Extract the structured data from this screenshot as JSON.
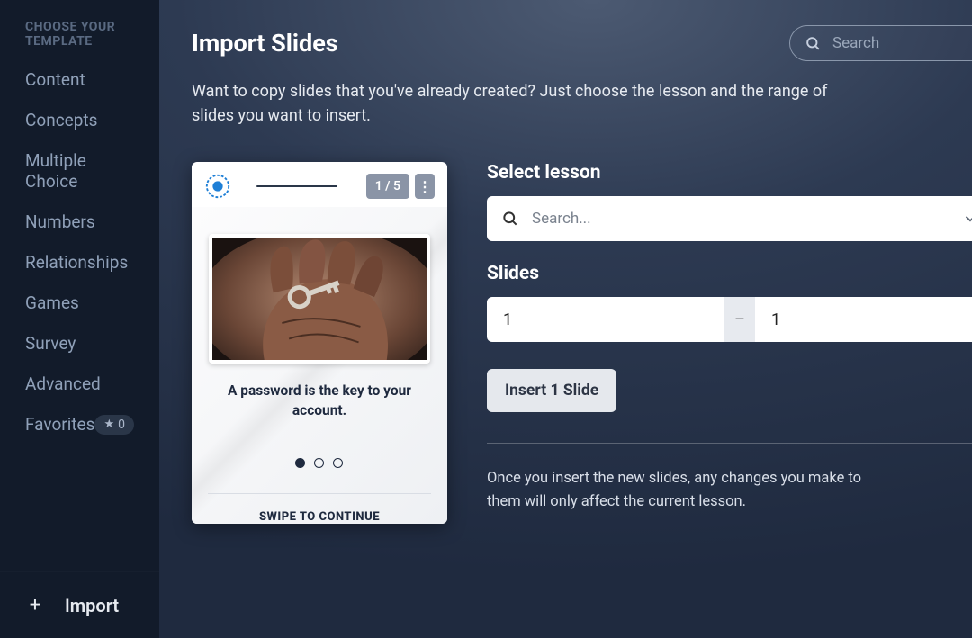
{
  "sidebar": {
    "header": "CHOOSE YOUR TEMPLATE",
    "items": [
      {
        "label": "Content"
      },
      {
        "label": "Concepts"
      },
      {
        "label": "Multiple Choice"
      },
      {
        "label": "Numbers"
      },
      {
        "label": "Relationships"
      },
      {
        "label": "Games"
      },
      {
        "label": "Survey"
      },
      {
        "label": "Advanced"
      }
    ],
    "favorites_label": "Favorites",
    "favorites_count": "0",
    "import_label": "Import"
  },
  "header": {
    "title": "Import Slides",
    "search_placeholder": "Search"
  },
  "description": "Want to copy slides that you've already created? Just choose the lesson and the range of slides you want to insert.",
  "preview": {
    "counter": "1 / 5",
    "caption": "A password is the key to your account.",
    "swipe": "SWIPE TO CONTINUE"
  },
  "form": {
    "lesson_label": "Select lesson",
    "lesson_placeholder": "Search...",
    "slides_label": "Slides",
    "range_from": "1",
    "range_to": "1",
    "insert_button": "Insert 1 Slide",
    "note": "Once you insert the new slides, any changes you make to them will only affect the current lesson."
  }
}
